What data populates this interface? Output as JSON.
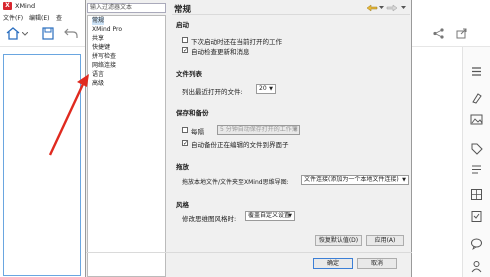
{
  "app": {
    "title": "XMind",
    "menu": [
      "文件(F)",
      "编辑(E)",
      "查"
    ]
  },
  "prefs": {
    "filter_placeholder": "输入过滤器文本",
    "tree_items": [
      "常规",
      "XMind Pro",
      "共享",
      "快捷键",
      "拼写检查",
      "网络连接",
      "语言",
      "高级"
    ],
    "page_title": "常规",
    "startup": {
      "heading": "启动",
      "opt1": "下次启动时还在当前打开的工作",
      "opt2": "自动检查更新和消息"
    },
    "file_list": {
      "heading": "文件列表",
      "label": "列出最近打开的文件:",
      "value": "20"
    },
    "save_backup": {
      "heading": "保存和备份",
      "every": "每隔",
      "interval": "5 分钟自动保存打开的工作簿",
      "backup": "自动备份正在编辑的文件到界面子"
    },
    "drag": {
      "heading": "拖放",
      "label": "拖放本地文件/文件夹至XMind思维导图:",
      "value": "文件连接(添加为一个本地文件连接)"
    },
    "style": {
      "heading": "风格",
      "label": "修改思维图风格时:",
      "value": "覆盖自定义设置"
    },
    "buttons": {
      "restore": "恢复默认值(D)",
      "apply": "应用(A)",
      "ok": "确定",
      "cancel": "取消"
    }
  },
  "colors": {
    "arrow": "#e02a1f",
    "selection": "#cde3f7",
    "logo": "#d8262f"
  }
}
